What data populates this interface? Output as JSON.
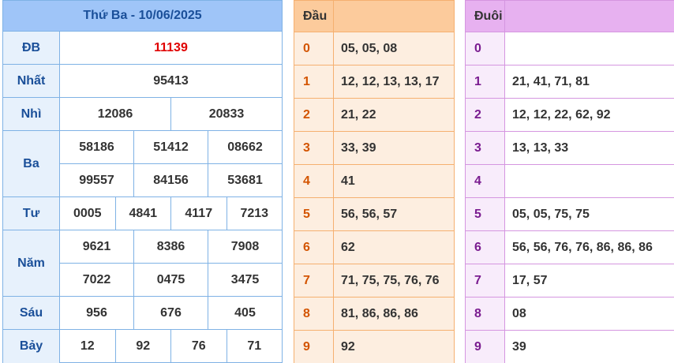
{
  "results": {
    "title": "Thứ Ba - 10/06/2025",
    "prizes": {
      "db": {
        "label": "ĐB",
        "values": [
          "11139"
        ]
      },
      "nhat": {
        "label": "Nhất",
        "values": [
          "95413"
        ]
      },
      "nhi": {
        "label": "Nhì",
        "values": [
          "12086",
          "20833"
        ]
      },
      "ba": {
        "label": "Ba",
        "values": [
          "58186",
          "51412",
          "08662",
          "99557",
          "84156",
          "53681"
        ]
      },
      "tu": {
        "label": "Tư",
        "values": [
          "0005",
          "4841",
          "4117",
          "7213"
        ]
      },
      "nam": {
        "label": "Năm",
        "values": [
          "9621",
          "8386",
          "7908",
          "7022",
          "0475",
          "3475"
        ]
      },
      "sau": {
        "label": "Sáu",
        "values": [
          "956",
          "676",
          "405"
        ]
      },
      "bay": {
        "label": "Bảy",
        "values": [
          "12",
          "92",
          "76",
          "71"
        ]
      }
    }
  },
  "dau": {
    "header": "Đầu",
    "rows": [
      {
        "key": "0",
        "value": "05, 05, 08"
      },
      {
        "key": "1",
        "value": "12, 12, 13, 13, 17"
      },
      {
        "key": "2",
        "value": "21, 22"
      },
      {
        "key": "3",
        "value": "33, 39"
      },
      {
        "key": "4",
        "value": "41"
      },
      {
        "key": "5",
        "value": "56, 56, 57"
      },
      {
        "key": "6",
        "value": "62"
      },
      {
        "key": "7",
        "value": "71, 75, 75, 76, 76"
      },
      {
        "key": "8",
        "value": "81, 86, 86, 86"
      },
      {
        "key": "9",
        "value": "92"
      }
    ]
  },
  "duoi": {
    "header": "Đuôi",
    "rows": [
      {
        "key": "0",
        "value": ""
      },
      {
        "key": "1",
        "value": "21, 41, 71, 81"
      },
      {
        "key": "2",
        "value": "12, 12, 22, 62, 92"
      },
      {
        "key": "3",
        "value": "13, 13, 33"
      },
      {
        "key": "4",
        "value": ""
      },
      {
        "key": "5",
        "value": "05, 05, 75, 75"
      },
      {
        "key": "6",
        "value": "56, 56, 76, 76, 86, 86, 86"
      },
      {
        "key": "7",
        "value": "17, 57"
      },
      {
        "key": "8",
        "value": "08"
      },
      {
        "key": "9",
        "value": "39"
      }
    ]
  },
  "colors": {
    "special_prize": "#e00000",
    "results_header": "#9fc5f8",
    "dau_header": "#fccb9c",
    "duoi_header": "#e7b1f0"
  }
}
